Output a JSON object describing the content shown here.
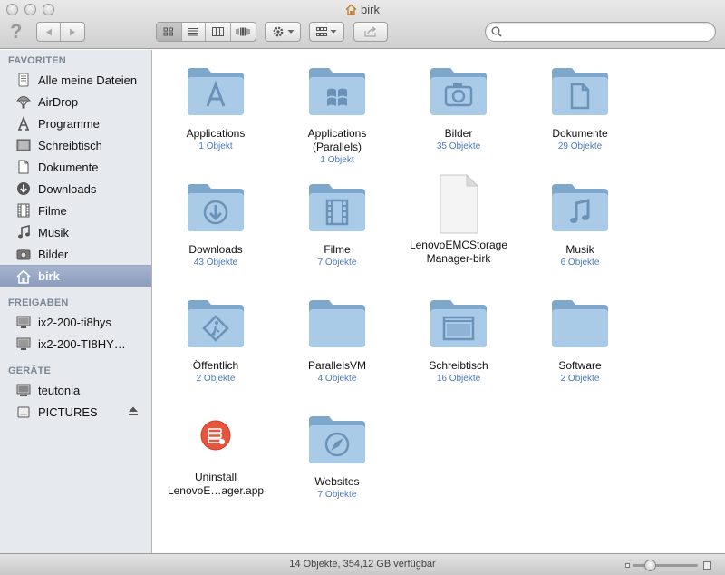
{
  "window": {
    "title": "birk",
    "title_icon": "home-icon"
  },
  "toolbar": {
    "help_glyph": "?",
    "search_placeholder": "",
    "view_modes": [
      "icon-view",
      "list-view",
      "column-view",
      "coverflow-view"
    ],
    "active_view": "icon-view"
  },
  "sidebar": {
    "favorites_header": "FAVORITEN",
    "favorites": [
      {
        "label": "Alle meine Dateien",
        "icon": "all-files-icon"
      },
      {
        "label": "AirDrop",
        "icon": "airdrop-icon"
      },
      {
        "label": "Programme",
        "icon": "applications-icon"
      },
      {
        "label": "Schreibtisch",
        "icon": "desktop-icon"
      },
      {
        "label": "Dokumente",
        "icon": "documents-icon"
      },
      {
        "label": "Downloads",
        "icon": "downloads-icon"
      },
      {
        "label": "Filme",
        "icon": "movies-icon"
      },
      {
        "label": "Musik",
        "icon": "music-icon"
      },
      {
        "label": "Bilder",
        "icon": "pictures-icon"
      },
      {
        "label": "birk",
        "icon": "home-icon",
        "selected": true
      }
    ],
    "shared_header": "FREIGABEN",
    "shared": [
      {
        "label": "ix2-200-ti8hys",
        "icon": "network-computer-icon"
      },
      {
        "label": "ix2-200-TI8HY…",
        "icon": "network-computer-icon"
      }
    ],
    "devices_header": "GERÄTE",
    "devices": [
      {
        "label": "teutonia",
        "icon": "computer-icon"
      },
      {
        "label": "PICTURES",
        "icon": "drive-icon",
        "ejectable": true
      }
    ]
  },
  "items": [
    {
      "name": "Applications",
      "count": "1 Objekt",
      "icon": "applications-folder"
    },
    {
      "name": "Applications\n(Parallels)",
      "count": "1 Objekt",
      "icon": "windows-folder"
    },
    {
      "name": "Bilder",
      "count": "35 Objekte",
      "icon": "pictures-folder"
    },
    {
      "name": "Dokumente",
      "count": "29 Objekte",
      "icon": "documents-folder"
    },
    {
      "name": "Downloads",
      "count": "43 Objekte",
      "icon": "downloads-folder"
    },
    {
      "name": "Filme",
      "count": "7 Objekte",
      "icon": "movies-folder"
    },
    {
      "name": "LenovoEMCStorage\nManager-birk",
      "count": "",
      "icon": "blank-document"
    },
    {
      "name": "Musik",
      "count": "6 Objekte",
      "icon": "music-folder"
    },
    {
      "name": "Öffentlich",
      "count": "2 Objekte",
      "icon": "public-folder"
    },
    {
      "name": "ParallelsVM",
      "count": "4 Objekte",
      "icon": "plain-folder"
    },
    {
      "name": "Schreibtisch",
      "count": "16 Objekte",
      "icon": "desktop-folder"
    },
    {
      "name": "Software",
      "count": "2 Objekte",
      "icon": "plain-folder"
    },
    {
      "name": "Uninstall\nLenovoE…ager.app",
      "count": "",
      "icon": "uninstaller-app"
    },
    {
      "name": "Websites",
      "count": "7 Objekte",
      "icon": "sites-folder"
    }
  ],
  "statusbar": {
    "text": "14 Objekte, 354,12 GB verfügbar",
    "icon_size_fraction": 0.22
  },
  "colors": {
    "selected_sidebar": "#94a4c3",
    "count_text": "#4a7bb8",
    "folder_body": "#8fb6d8",
    "uninstaller": "#e8553d"
  }
}
